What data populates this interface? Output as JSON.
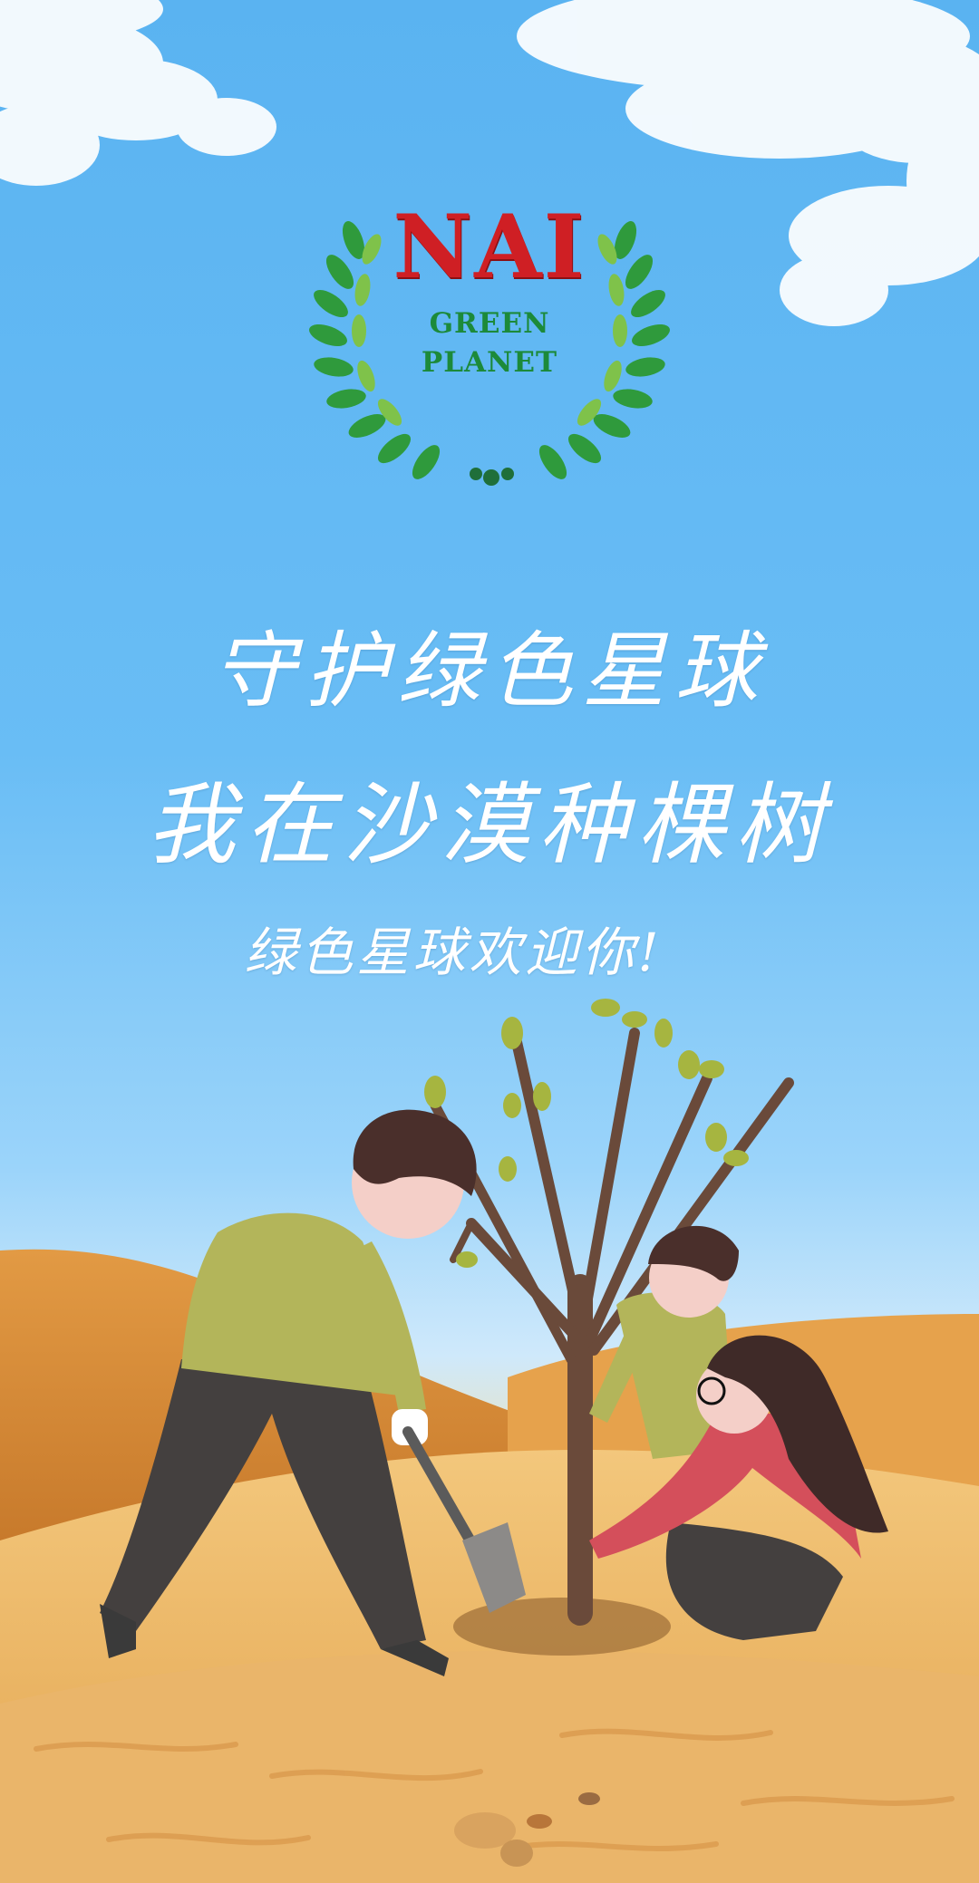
{
  "logo": {
    "brand": "NAI",
    "line1": "GREEN",
    "line2": "PLANET"
  },
  "slogan": {
    "line1": "守护绿色星球",
    "line2": "我在沙漠种棵树",
    "line3": "绿色星球欢迎你!"
  },
  "illustration": {
    "subject": "family-planting-tree-in-desert",
    "colors": {
      "sky": "#5ab3f1",
      "sand": "#e8b15c",
      "dune_dark": "#cf8632",
      "leaf_green": "#2f9a3c",
      "brand_red": "#cf1f24"
    }
  }
}
